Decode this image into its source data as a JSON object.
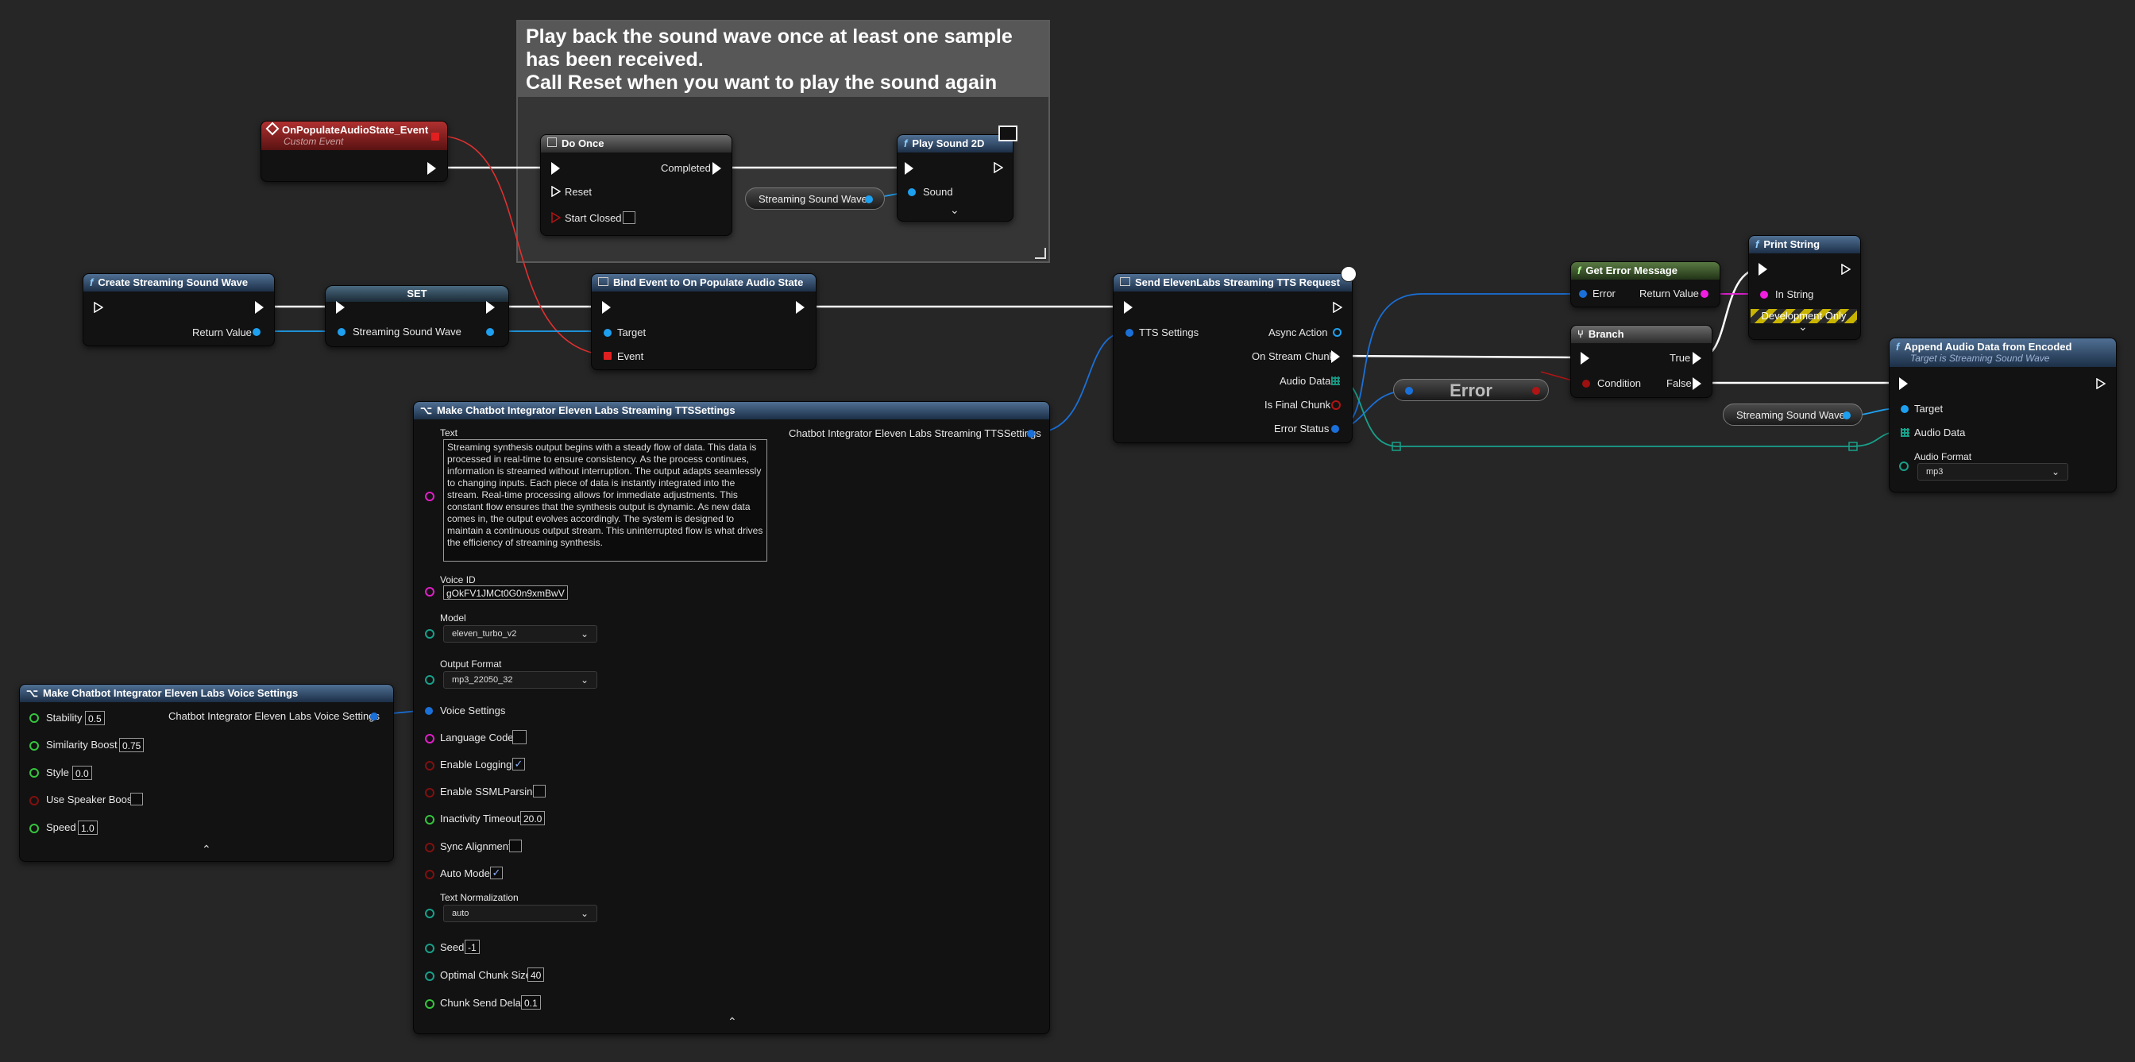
{
  "comment": {
    "title": "Play back the sound wave once at least one sample has been received.\nCall Reset when you want to play the sound again"
  },
  "nodes": {
    "custom_event": {
      "title": "OnPopulateAudioState_Event",
      "subtitle": "Custom Event"
    },
    "do_once": {
      "title": "Do Once",
      "completed": "Completed",
      "reset": "Reset",
      "start_closed": "Start Closed"
    },
    "play_sound": {
      "title": "Play Sound 2D",
      "sound": "Sound"
    },
    "streaming_sound_wave_var_1": {
      "label": "Streaming Sound Wave"
    },
    "create_wave": {
      "title": "Create Streaming Sound Wave",
      "return_value": "Return Value"
    },
    "set_node": {
      "title": "SET",
      "pin": "Streaming Sound Wave"
    },
    "bind_event": {
      "title": "Bind Event to On Populate Audio State",
      "target": "Target",
      "event": "Event"
    },
    "send_request": {
      "title": "Send ElevenLabs Streaming TTS Request",
      "tts_settings": "TTS Settings",
      "async_action": "Async Action",
      "on_stream_chunk": "On Stream Chunk",
      "audio_data": "Audio Data",
      "is_final_chunk": "Is Final Chunk",
      "error_status": "Error Status"
    },
    "get_error": {
      "title": "Get Error Message",
      "error": "Error",
      "return_value": "Return Value"
    },
    "print_string": {
      "title": "Print String",
      "in_string": "In String",
      "dev_only": "Development Only"
    },
    "error_var": {
      "label": "Error"
    },
    "branch": {
      "title": "Branch",
      "condition": "Condition",
      "true_label": "True",
      "false_label": "False"
    },
    "streaming_sound_wave_var_2": {
      "label": "Streaming Sound Wave"
    },
    "append_audio": {
      "title": "Append Audio Data from Encoded",
      "subtitle": "Target is Streaming Sound Wave",
      "target": "Target",
      "audio_data": "Audio Data",
      "audio_format_label": "Audio Format",
      "audio_format_value": "mp3"
    },
    "make_tts": {
      "title": "Make Chatbot Integrator Eleven Labs Streaming TTSSettings",
      "output": "Chatbot Integrator Eleven Labs Streaming TTSSettings",
      "text_label": "Text",
      "text_value": "Streaming synthesis output begins with a steady flow of data. This data is processed in real-time to ensure consistency. As the process continues, information is streamed without interruption. The output adapts seamlessly to changing inputs. Each piece of data is instantly integrated into the stream. Real-time processing allows for immediate adjustments. This constant flow ensures that the synthesis output is dynamic. As new data comes in, the output evolves accordingly. The system is designed to maintain a continuous output stream. This uninterrupted flow is what drives the efficiency of streaming synthesis.",
      "voice_id_label": "Voice ID",
      "voice_id_value": "gOkFV1JMCt0G0n9xmBwV",
      "model_label": "Model",
      "model_value": "eleven_turbo_v2",
      "output_format_label": "Output Format",
      "output_format_value": "mp3_22050_32",
      "voice_settings": "Voice Settings",
      "language_code": "Language Code",
      "enable_logging": "Enable Logging",
      "enable_ssml": "Enable SSMLParsing",
      "inactivity_timeout": "Inactivity Timeout",
      "inactivity_timeout_value": "20.0",
      "sync_alignment": "Sync Alignment",
      "auto_mode": "Auto Mode",
      "text_normalization_label": "Text Normalization",
      "text_normalization_value": "auto",
      "seed": "Seed",
      "seed_value": "-1",
      "optimal_chunk_size": "Optimal Chunk Size",
      "optimal_chunk_size_value": "40",
      "chunk_send_delay": "Chunk Send Delay",
      "chunk_send_delay_value": "0.1"
    },
    "make_voice": {
      "title": "Make Chatbot Integrator Eleven Labs Voice Settings",
      "output": "Chatbot Integrator Eleven Labs Voice Settings",
      "stability": "Stability",
      "stability_value": "0.5",
      "similarity_boost": "Similarity Boost",
      "similarity_boost_value": "0.75",
      "style": "Style",
      "style_value": "0.0",
      "use_speaker_boost": "Use Speaker Boost",
      "speed": "Speed",
      "speed_value": "1.0"
    }
  }
}
